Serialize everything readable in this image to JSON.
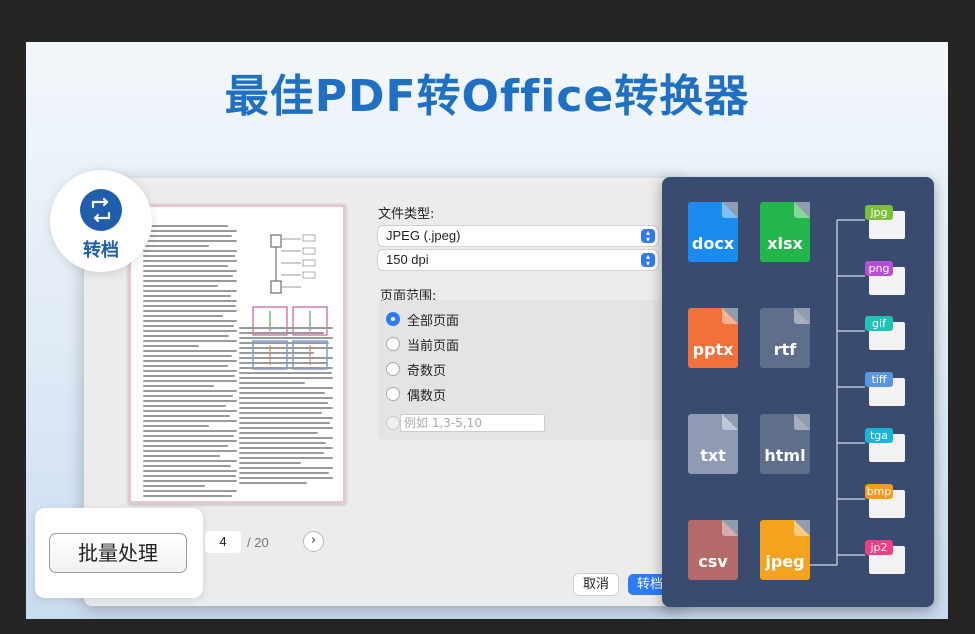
{
  "headline": "最佳PDF转Office转换器",
  "badge": {
    "label": "转档",
    "icon": "convert-icon"
  },
  "batch": {
    "label": "批量处理"
  },
  "pager": {
    "current_page": "4",
    "total": "/ 20"
  },
  "settings": {
    "file_type_label": "文件类型:",
    "file_type_value": "JPEG (.jpeg)",
    "dpi_value": "150 dpi",
    "page_range_label": "页面范围:",
    "options": [
      "全部页面",
      "当前页面",
      "奇数页",
      "偶数页"
    ],
    "selected_option": "全部页面",
    "custom_range_placeholder": "例如 1,3-5,10"
  },
  "actions": {
    "cancel": "取消",
    "convert": "转档"
  },
  "formats": [
    {
      "label": "docx",
      "color": "#1a8cf0"
    },
    {
      "label": "xlsx",
      "color": "#22b64c"
    },
    {
      "label": "pptx",
      "color": "#f2713a"
    },
    {
      "label": "rtf",
      "color": "#5f6e8a"
    },
    {
      "label": "txt",
      "color": "#8f9bb5"
    },
    {
      "label": "html",
      "color": "#5f6e8a"
    },
    {
      "label": "csv",
      "color": "#b56a6a"
    },
    {
      "label": "jpeg",
      "color": "#f5a21e"
    }
  ],
  "image_formats": [
    {
      "label": "jpg",
      "color": "#7bbf3a"
    },
    {
      "label": "png",
      "color": "#b74fd6"
    },
    {
      "label": "gif",
      "color": "#21c4b4"
    },
    {
      "label": "tiff",
      "color": "#5a96e0"
    },
    {
      "label": "tga",
      "color": "#19b6d8"
    },
    {
      "label": "bmp",
      "color": "#f59a1c"
    },
    {
      "label": "jp2",
      "color": "#ee3f83"
    }
  ]
}
